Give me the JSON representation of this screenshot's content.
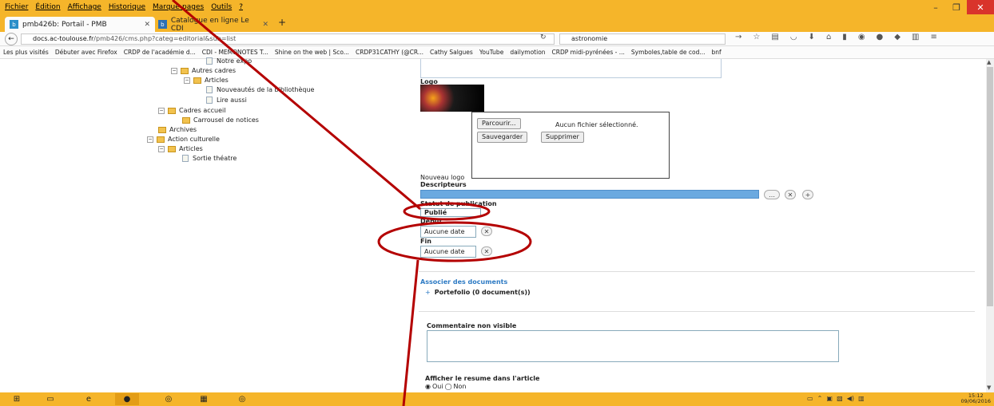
{
  "menubar": {
    "items": [
      "Fichier",
      "Édition",
      "Affichage",
      "Historique",
      "Marque-pages",
      "Outils",
      "?"
    ]
  },
  "tabs": [
    {
      "label": "pmb426b: Portail - PMB",
      "icon": "pmb-favicon"
    },
    {
      "label": "Catalogue en ligne Le CDI",
      "icon": "catalogue-favicon"
    }
  ],
  "navbar": {
    "url_host": "docs.ac-toulouse.fr",
    "url_path": "/pmb426/cms.php?categ=editorial&sub=list",
    "search_value": "astronomie"
  },
  "bookmarks": [
    "Les plus visités",
    "Débuter avec Firefox",
    "CRDP de l'académie d...",
    "CDI - MEMONOTES T...",
    "Shine on the web | Sco...",
    "CRDP31CATHY (@CR...",
    "Cathy Salgues",
    "YouTube",
    "dailymotion",
    "CRDP midi-pyrénées - ...",
    "Symboles,table de cod...",
    "bnf"
  ],
  "tree": {
    "items": [
      {
        "label": "Notre expo",
        "type": "page"
      },
      {
        "label": "Autres cadres",
        "type": "folder"
      },
      {
        "label": "Articles",
        "type": "folder"
      },
      {
        "label": "Nouveautés de la bibliothèque",
        "type": "page"
      },
      {
        "label": "Lire aussi",
        "type": "page"
      },
      {
        "label": "Cadres accueil",
        "type": "folder"
      },
      {
        "label": "Carrousel de notices",
        "type": "folder"
      },
      {
        "label": "Archives",
        "type": "folder"
      },
      {
        "label": "Action culturelle",
        "type": "folder"
      },
      {
        "label": "Articles",
        "type": "folder"
      },
      {
        "label": "Sortie théatre",
        "type": "page"
      }
    ]
  },
  "form": {
    "logo_label": "Logo",
    "browse_button": "Parcourir...",
    "no_file_text": "Aucun fichier sélectionné.",
    "save_button": "Sauvegarder",
    "delete_button": "Supprimer",
    "new_logo_label": "Nouveau logo",
    "descriptors_label": "Descripteurs",
    "publication_status_label": "Statut de publication",
    "publication_status_value": "Publié",
    "start_label": "Début",
    "start_value": "Aucune date",
    "end_label": "Fin",
    "end_value": "Aucune date",
    "associate_docs_link": "Associer des documents",
    "portfolio_label": "Portefolio (0 document(s))",
    "comment_label": "Commentaire non visible",
    "summary_label": "Afficher le resume dans l'article",
    "summary_yes": "Oui",
    "summary_no": "Non"
  },
  "taskbar": {
    "time": "15:12",
    "date": "09/06/2016"
  },
  "colors": {
    "chrome_orange": "#f5b52a",
    "annotation_red": "#b40000",
    "descriptor_bar": "#6aa9e0"
  }
}
